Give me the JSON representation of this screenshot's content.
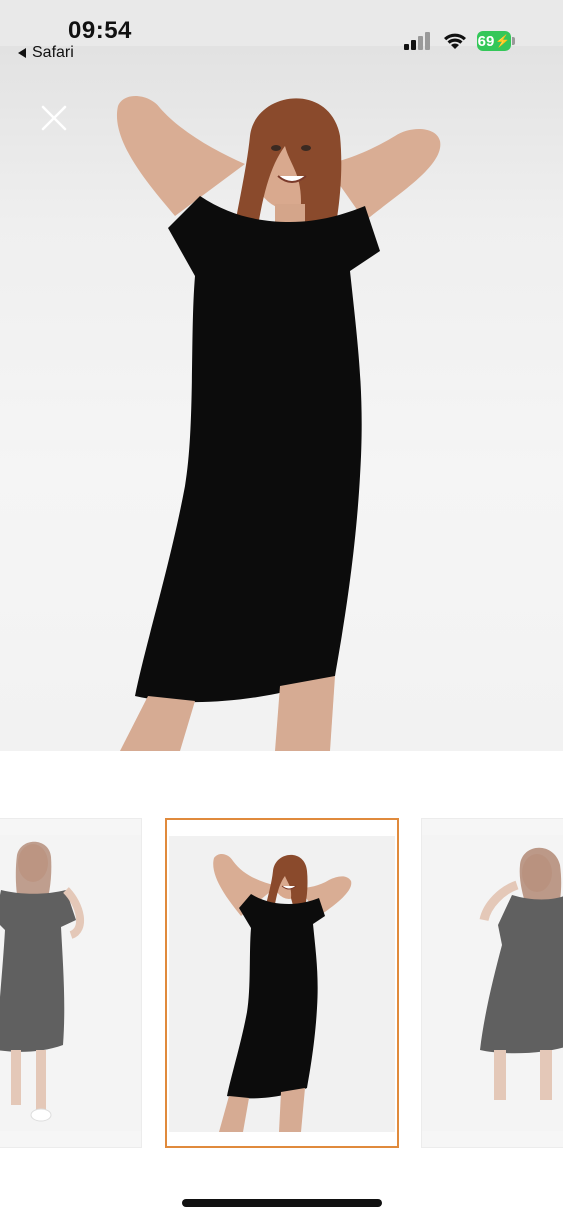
{
  "status_bar": {
    "time": "09:54",
    "back_app_label": "Safari",
    "battery_level": "69",
    "battery_color": "#34c759",
    "signal_icon": "cellular-signal-icon",
    "wifi_icon": "wifi-icon",
    "charging_icon": "bolt-icon"
  },
  "viewer": {
    "close_icon": "close-icon",
    "hero_image": "model in black short-sleeve midi dress, hands behind head"
  },
  "thumbnails": {
    "selected_index": 1,
    "accent_color": "#e08a3c",
    "items": [
      {
        "image": "model in black dress, side pose"
      },
      {
        "image": "model in black dress, hands behind head"
      },
      {
        "image": "model in black dress, turned pose"
      }
    ]
  }
}
